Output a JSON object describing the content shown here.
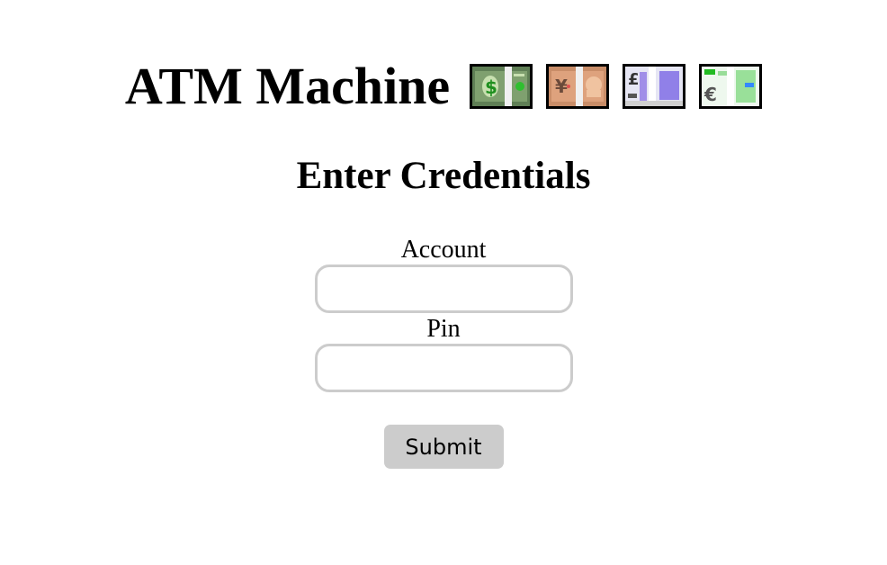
{
  "header": {
    "title": "ATM Machine",
    "bill_icons": [
      {
        "name": "dollar-bill-icon",
        "currency": "$",
        "bg": "#6b8f5e",
        "accent": "#2fa12f"
      },
      {
        "name": "yen-bill-icon",
        "currency": "¥",
        "bg": "#d9a07a",
        "accent": "#b97b55"
      },
      {
        "name": "pound-bill-icon",
        "currency": "£",
        "bg": "#dcdcf2",
        "accent": "#9a85e8"
      },
      {
        "name": "euro-bill-icon",
        "currency": "€",
        "bg": "#e6f5e6",
        "accent": "#55cc55"
      }
    ]
  },
  "form": {
    "heading": "Enter Credentials",
    "account_label": "Account",
    "account_value": "",
    "pin_label": "Pin",
    "pin_value": "",
    "submit_label": "Submit"
  },
  "colors": {
    "input_border": "#cccccc",
    "button_bg": "#cccccc"
  }
}
